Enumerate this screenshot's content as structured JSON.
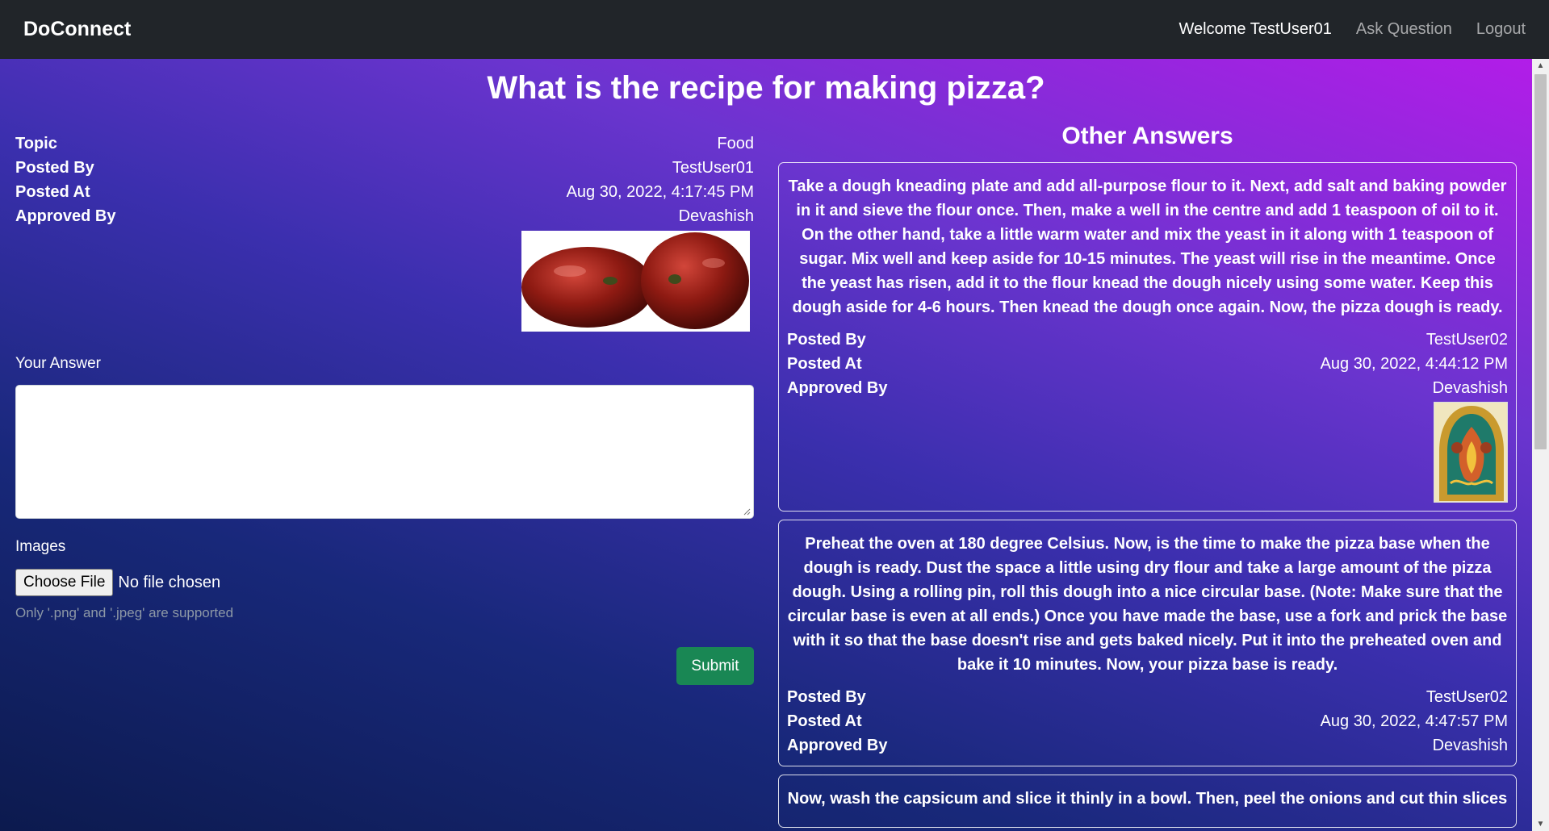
{
  "navbar": {
    "brand": "DoConnect",
    "welcome": "Welcome TestUser01",
    "ask_question": "Ask Question",
    "logout": "Logout"
  },
  "question": {
    "title": "What is the recipe for making pizza?",
    "meta": [
      {
        "label": "Topic",
        "value": "Food"
      },
      {
        "label": "Posted By",
        "value": "TestUser01"
      },
      {
        "label": "Posted At",
        "value": "Aug 30, 2022, 4:17:45 PM"
      },
      {
        "label": "Approved By",
        "value": "Devashish"
      }
    ]
  },
  "answer_form": {
    "your_answer_label": "Your Answer",
    "answer_value": "",
    "images_label": "Images",
    "choose_file": "Choose File",
    "file_status": "No file chosen",
    "hint": "Only '.png' and '.jpeg' are supported",
    "submit": "Submit"
  },
  "other_answers": {
    "heading": "Other Answers",
    "answers": [
      {
        "text": "Take a dough kneading plate and add all-purpose flour to it. Next, add salt and baking powder in it and sieve the flour once. Then, make a well in the centre and add 1 teaspoon of oil to it. On the other hand, take a little warm water and mix the yeast in it along with 1 teaspoon of sugar. Mix well and keep aside for 10-15 minutes. The yeast will rise in the meantime. Once the yeast has risen, add it to the flour knead the dough nicely using some water. Keep this dough aside for 4-6 hours. Then knead the dough once again. Now, the pizza dough is ready.",
        "posted_by_label": "Posted By",
        "posted_by": "TestUser02",
        "posted_at_label": "Posted At",
        "posted_at": "Aug 30, 2022, 4:44:12 PM",
        "approved_by_label": "Approved By",
        "approved_by": "Devashish"
      },
      {
        "text": "Preheat the oven at 180 degree Celsius. Now, is the time to make the pizza base when the dough is ready. Dust the space a little using dry flour and take a large amount of the pizza dough. Using a rolling pin, roll this dough into a nice circular base. (Note: Make sure that the circular base is even at all ends.) Once you have made the base, use a fork and prick the base with it so that the base doesn't rise and gets baked nicely. Put it into the preheated oven and bake it 10 minutes. Now, your pizza base is ready.",
        "posted_by_label": "Posted By",
        "posted_by": "TestUser02",
        "posted_at_label": "Posted At",
        "posted_at": "Aug 30, 2022, 4:47:57 PM",
        "approved_by_label": "Approved By",
        "approved_by": "Devashish"
      },
      {
        "text": "Now, wash the capsicum and slice it thinly in a bowl. Then, peel the onions and cut thin slices"
      }
    ]
  }
}
